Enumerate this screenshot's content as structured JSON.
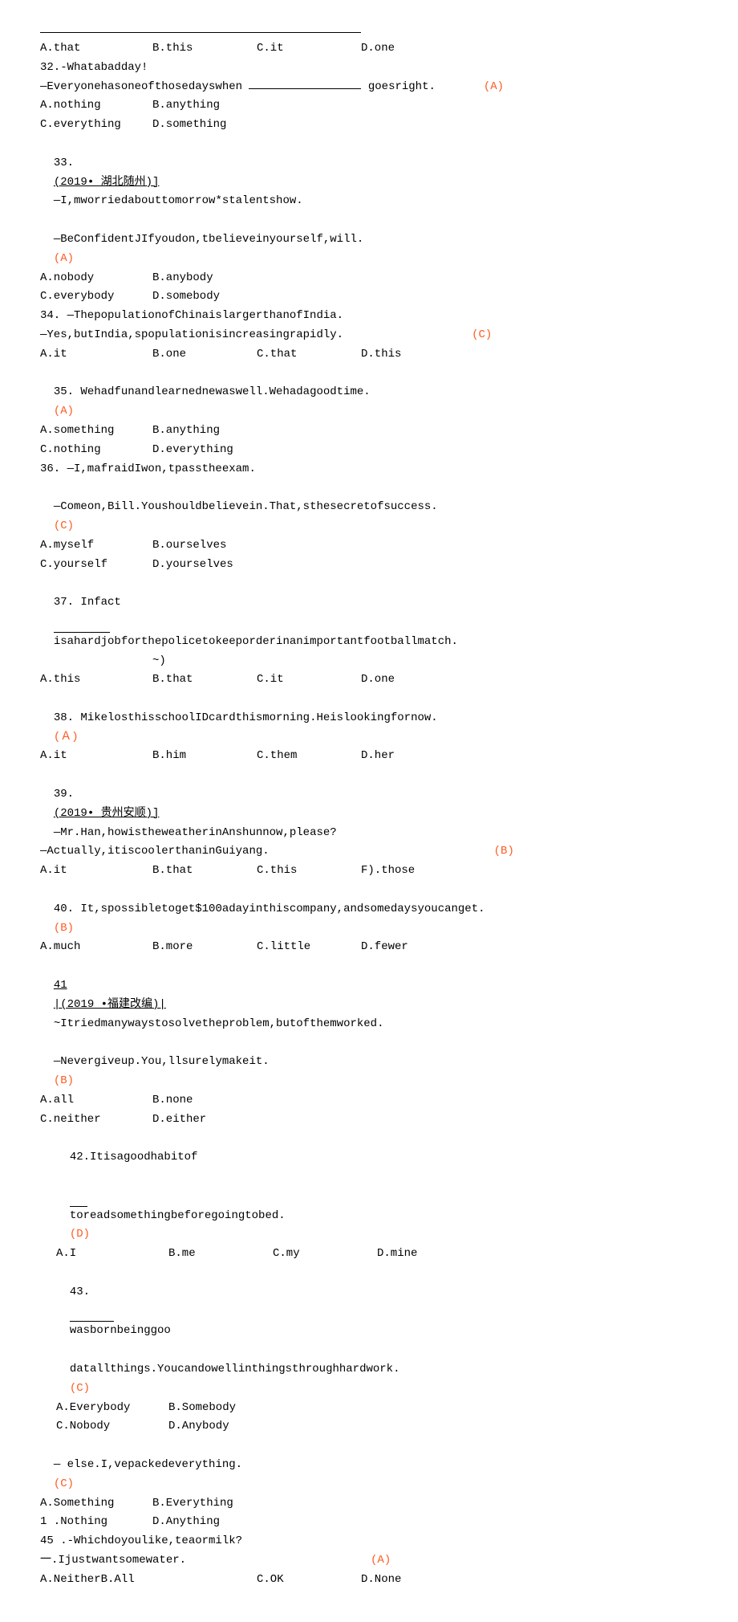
{
  "hr": " ",
  "q31": {
    "a": "A.that",
    "b": "B.this",
    "c": "C.it",
    "d": "D.one"
  },
  "q32": {
    "title": "32.-Whatabadday!",
    "line2a": "—Everyonehasoneofthosedayswhen",
    "line2b": "goesright.",
    "ans": "(A)",
    "a": "A.nothing",
    "b": "B.anything",
    "c": "C.everything",
    "d": "D.something"
  },
  "q33": {
    "title": "33.",
    "link": "(2019• 湖北随州)]",
    "tail": "—I,mworriedabouttomorrow*stalentshow.",
    "line2": "—BeConfidentJIfyoudon,tbelieveinyourself,will.",
    "ans": "(A)",
    "a": "A.nobody",
    "b": "B.anybody",
    "c": "C.everybody",
    "d": "D.somebody"
  },
  "q34": {
    "title": "34. —ThepopulationofChinaislargerthanofIndia.",
    "line2": "—Yes,butIndia,spopulationisincreasingrapidly.",
    "ans": "(C)",
    "a": "A.it",
    "b": "B.one",
    "c": "C.that",
    "d": "D.this"
  },
  "q35": {
    "title": "35. Wehadfunandlearnednewaswell.Wehadagoodtime.",
    "ans": "(A)",
    "a": "A.something",
    "b": "B.anything",
    "c": "C.nothing",
    "d": "D.everything"
  },
  "q36": {
    "title": "36. —I,mafraidIwon,tpasstheexam.",
    "line2": "—Comeon,Bill.Youshouldbelievein.That,sthesecretofsuccess.",
    "ans": "(C)",
    "a": "A.myself",
    "b": "B.ourselves",
    "c": "C.yourself",
    "d": "D.yourselves"
  },
  "q37": {
    "title": "37. Infact ",
    "tail": "isahardjobforthepolicetokeeporderinanimportantfootballmatch.",
    "line2": "~)",
    "a": "A.this",
    "b": "B.that",
    "c": "C.it",
    "d": "D.one"
  },
  "q38": {
    "title": "38. MikelosthisschoolIDcardthismorning.Heislookingfornow.",
    "ans": "(Ａ)",
    "a": "A.it",
    "b": "B.him",
    "c": "C.them",
    "d": "D.her"
  },
  "q39": {
    "title": "39.",
    "link": "(2019• 贵州安顺)]",
    "tail": "—Mr.Han,howistheweatherinAnshunnow,please?",
    "line2": "—Actually,itiscoolerthaninGuiyang.",
    "ans": "(B)",
    "a": "A.it",
    "b": "B.that",
    "c": "C.this",
    "d": "F).those"
  },
  "q40": {
    "title": "40. It,spossibletoget$100adayinthiscompany,andsomedaysyoucanget.",
    "ans": "(B)",
    "a": "A.much",
    "b": "B.more",
    "c": "C.little",
    "d": "D.fewer"
  },
  "q41": {
    "title": "41",
    "link": "|(2019 •福建改编)|",
    "tail": "~Itriedmanywaystosolvetheproblem,butofthemworked.",
    "line2": "—Nevergiveup.You,llsurelymakeit.",
    "ans": "(B)",
    "a": "A.all",
    "b": "B.none",
    "c": "C.neither",
    "d": "D.either"
  },
  "q42": {
    "title": "42.Itisagoodhabitof",
    "tail": "toreadsomethingbeforegoingtobed.",
    "ans": "(D)",
    "a": "A.I",
    "b": "B.me",
    "c": "C.my",
    "d": "D.mine"
  },
  "q43": {
    "title": "43.",
    "tail1": "wasbornbeinggoo",
    "tail2": "datallthings.Youcandowellinthingsthroughhardwork.",
    "ans": "(C)",
    "a": "A.Everybody",
    "b": "B.Somebody",
    "c": "C.Nobody",
    "d": "D.Anybody"
  },
  "q44": {
    "title": "— else.I,vepackedeverything.",
    "ans": "(C)",
    "a": "A.Something",
    "b": "B.Everything",
    "c": "1 .Nothing",
    "d": "D.Anything"
  },
  "q45": {
    "title": "45 .-Whichdoyoulike,teaormilk?",
    "line2": "一.Ijustwantsomewater.",
    "ans": "(A)",
    "a": "A.NeitherB.All",
    "c": "C.OK",
    "d": "D.None"
  }
}
